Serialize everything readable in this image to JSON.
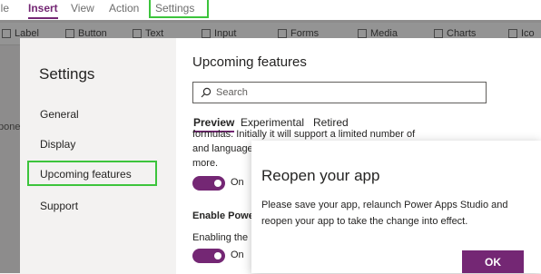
{
  "menubar": {
    "items": [
      {
        "label": "ile"
      },
      {
        "label": "Insert"
      },
      {
        "label": "View"
      },
      {
        "label": "Action"
      },
      {
        "label": "Settings"
      }
    ]
  },
  "ribbon": {
    "items": [
      {
        "label": "Label"
      },
      {
        "label": "Button"
      },
      {
        "label": "Text"
      },
      {
        "label": "Input"
      },
      {
        "label": "Forms"
      },
      {
        "label": "Media"
      },
      {
        "label": "Charts"
      },
      {
        "label": "Ico"
      }
    ]
  },
  "canvas": {
    "fragment": "pone"
  },
  "settings": {
    "title": "Settings",
    "nav": [
      {
        "label": "General"
      },
      {
        "label": "Display"
      },
      {
        "label": "Upcoming features"
      },
      {
        "label": "Support"
      }
    ],
    "content": {
      "title": "Upcoming features",
      "search_placeholder": "Search",
      "tabs": [
        {
          "label": "Preview"
        },
        {
          "label": "Experimental"
        },
        {
          "label": "Retired"
        }
      ],
      "desc_line1": "formulas. Initially it will support a limited number of regions",
      "desc_line2": "and language",
      "desc_line3": "more.",
      "toggle1_label": "On",
      "feature2_label": "Enable Powe",
      "feature2_desc": "Enabling the",
      "toggle2_label": "On"
    }
  },
  "reopen_dialog": {
    "title": "Reopen your app",
    "body": "Please save your app, relaunch Power Apps Studio and reopen your app to take the change into effect.",
    "ok_label": "OK"
  },
  "colors": {
    "accent": "#742774",
    "highlight": "#3cc43c"
  }
}
